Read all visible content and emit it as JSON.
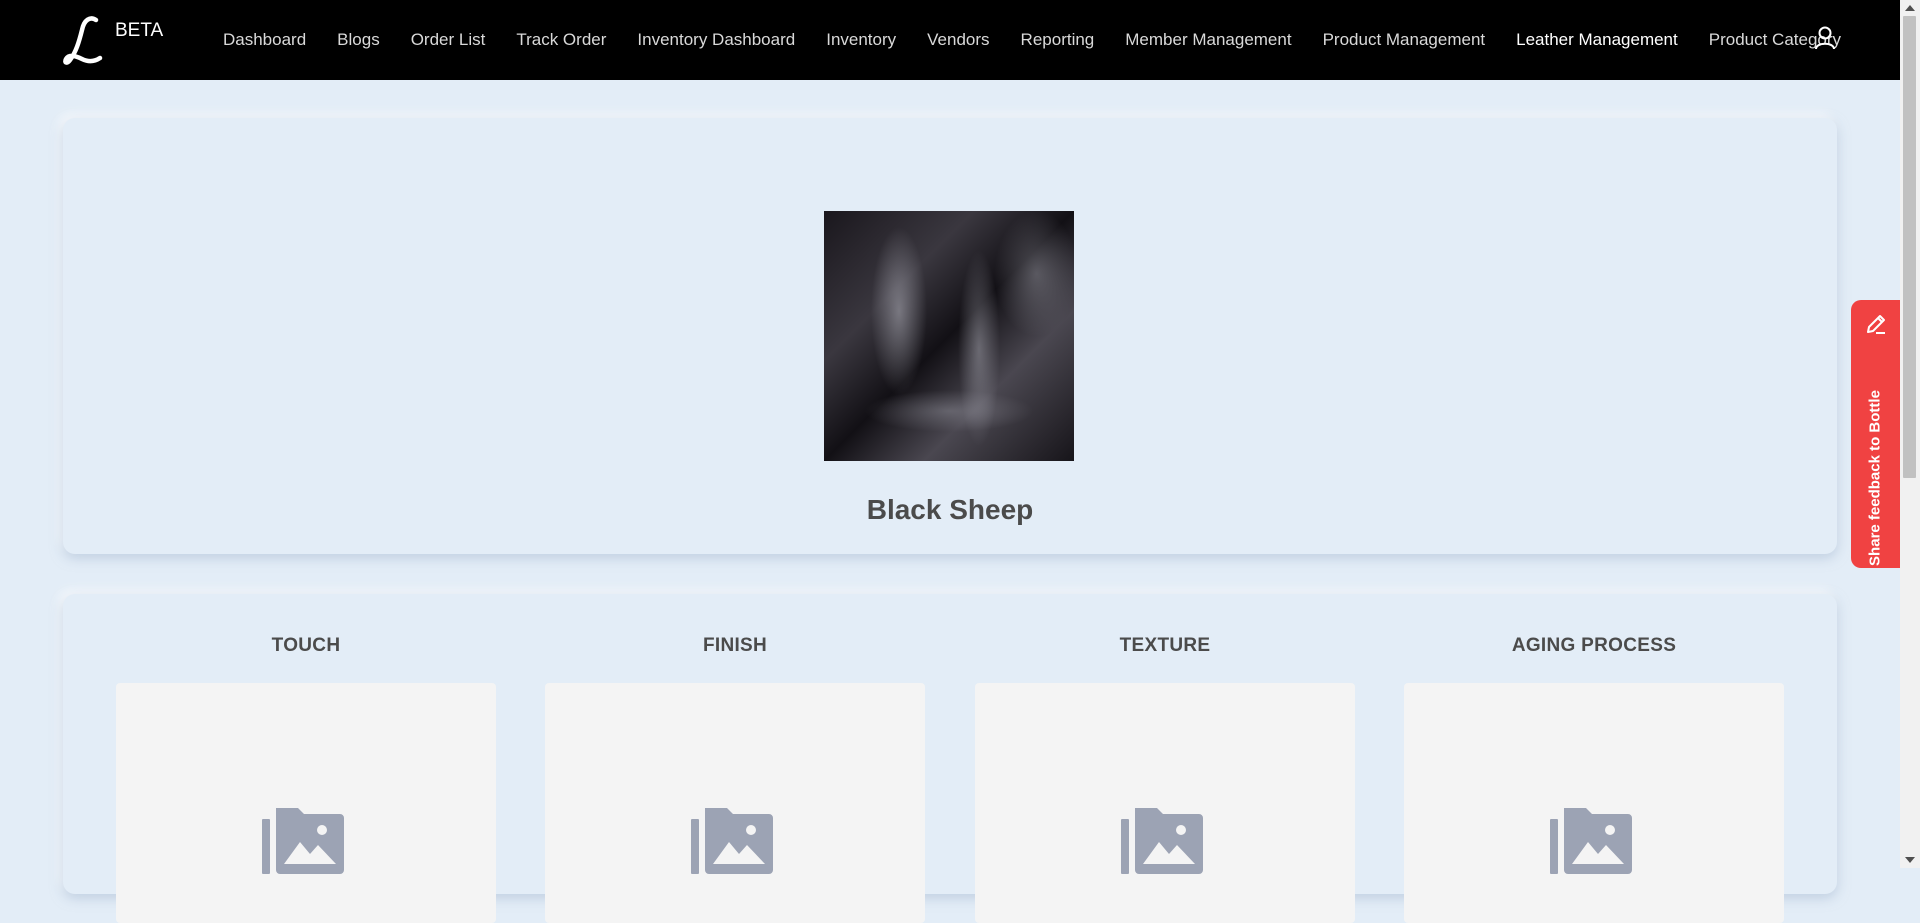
{
  "brand": {
    "logo_letter": "L",
    "badge": "BETA"
  },
  "nav": {
    "items": [
      {
        "label": "Dashboard"
      },
      {
        "label": "Blogs"
      },
      {
        "label": "Order List"
      },
      {
        "label": "Track Order"
      },
      {
        "label": "Inventory Dashboard"
      },
      {
        "label": "Inventory"
      },
      {
        "label": "Vendors"
      },
      {
        "label": "Reporting"
      },
      {
        "label": "Member Management"
      },
      {
        "label": "Product Management"
      },
      {
        "label": "Leather Management"
      },
      {
        "label": "Product Category"
      }
    ],
    "active": "Leather Management",
    "user_icon": "user-icon"
  },
  "hero": {
    "title": "Black Sheep"
  },
  "properties": [
    {
      "title": "TOUCH",
      "icon": "image-folder-icon"
    },
    {
      "title": "FINISH",
      "icon": "image-folder-icon"
    },
    {
      "title": "TEXTURE",
      "icon": "image-folder-icon"
    },
    {
      "title": "AGING PROCESS",
      "icon": "image-folder-icon"
    }
  ],
  "feedback": {
    "label": "Share feedback to Bottle",
    "icon": "pen-icon"
  },
  "colors": {
    "nav_bg": "#000000",
    "page_bg": "#e3edf7",
    "feedback_bg": "#f04242",
    "placeholder_icon": "#9ca3b4"
  }
}
